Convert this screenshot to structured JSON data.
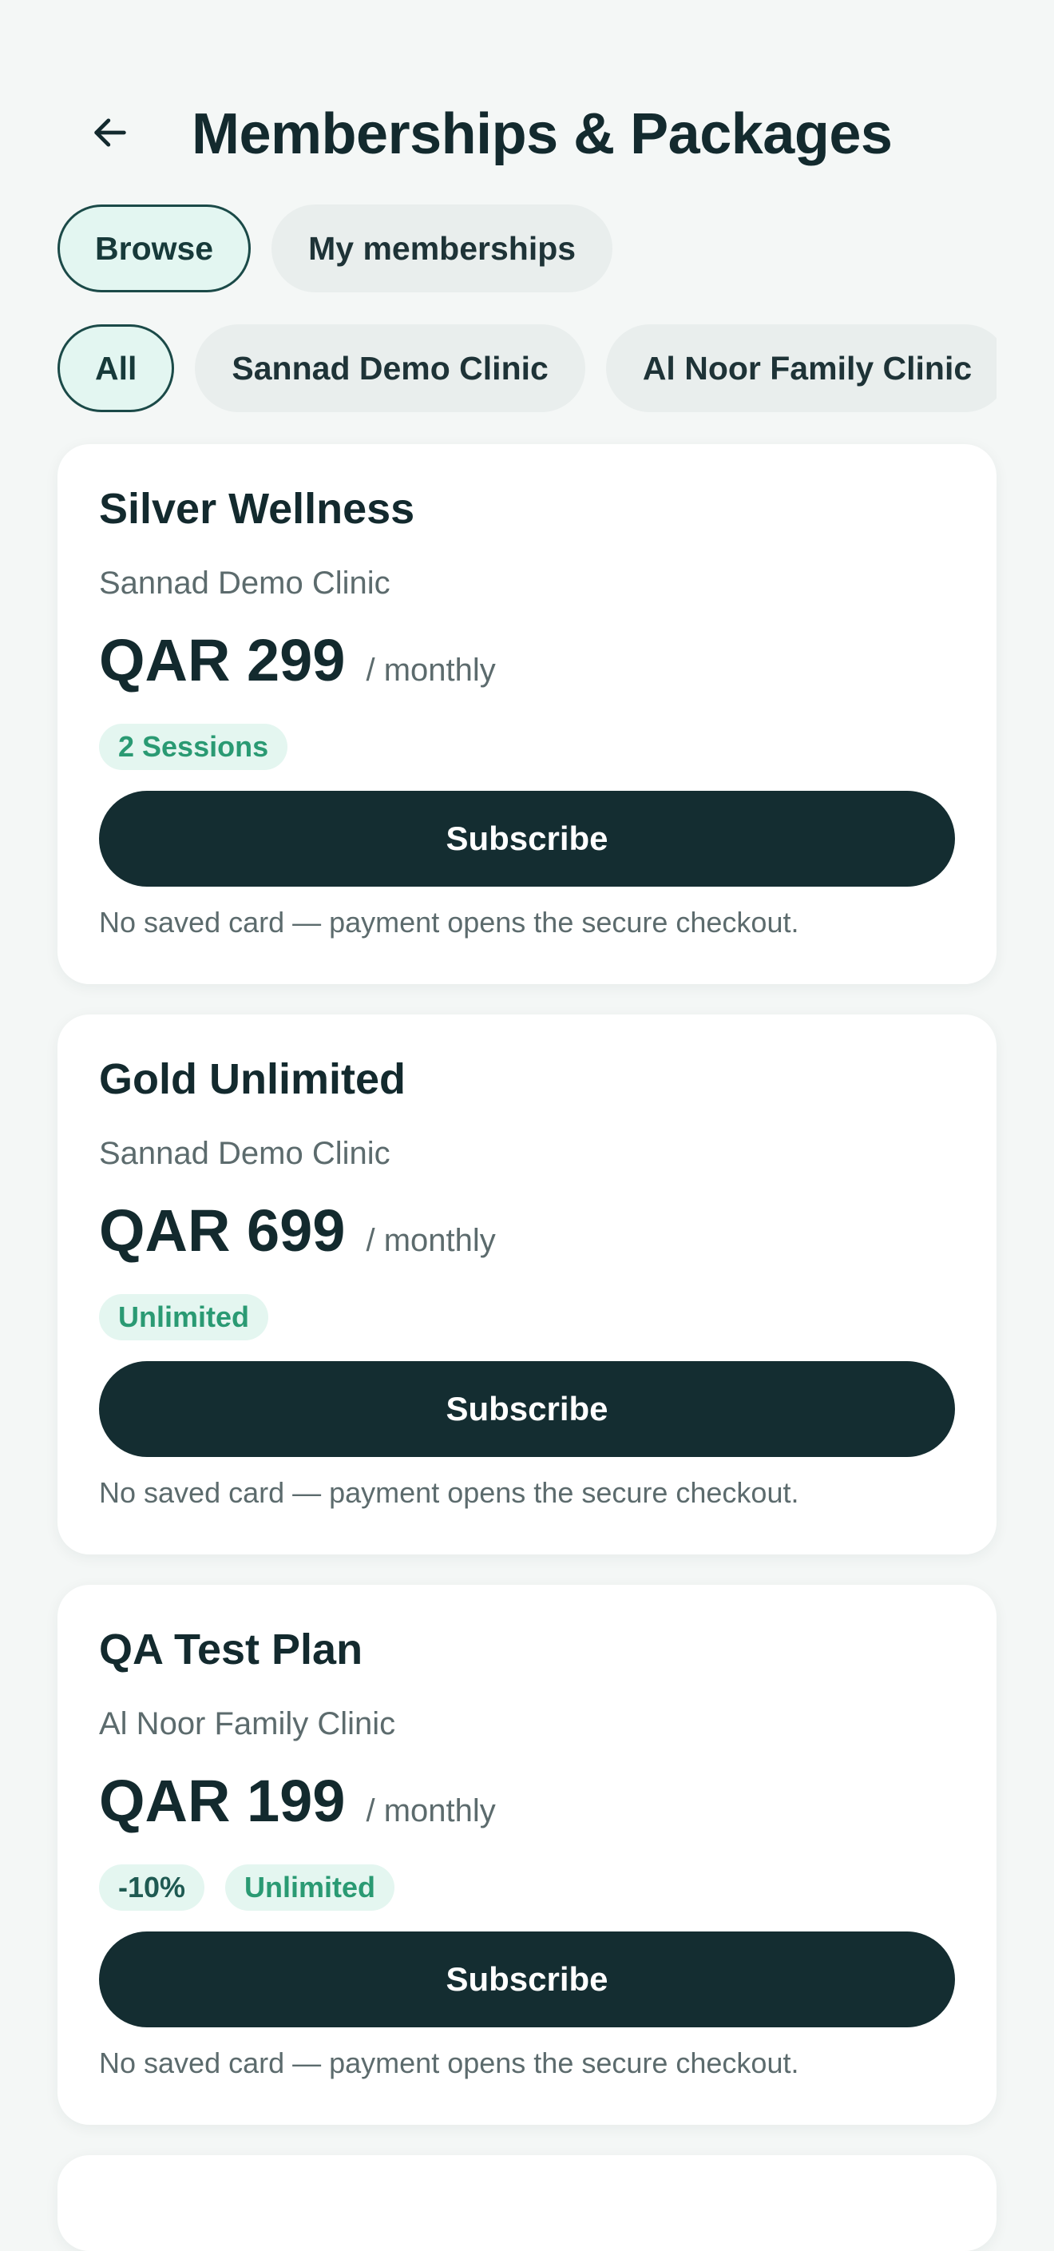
{
  "header": {
    "title": "Memberships & Packages",
    "back_icon": "arrow-left-icon"
  },
  "tabs": [
    {
      "label": "Browse",
      "active": true
    },
    {
      "label": "My memberships",
      "active": false
    }
  ],
  "clinic_filters": [
    {
      "label": "All",
      "active": true
    },
    {
      "label": "Sannad Demo Clinic",
      "active": false
    },
    {
      "label": "Al Noor Family Clinic",
      "active": false
    }
  ],
  "plans": [
    {
      "name": "Silver Wellness",
      "clinic": "Sannad Demo Clinic",
      "price": "QAR 299",
      "period": "/ monthly",
      "badges": [
        "2 Sessions"
      ],
      "button": "Subscribe",
      "note": "No saved card — payment opens the secure checkout."
    },
    {
      "name": "Gold Unlimited",
      "clinic": "Sannad Demo Clinic",
      "price": "QAR 699",
      "period": "/ monthly",
      "badges": [
        "Unlimited"
      ],
      "button": "Subscribe",
      "note": "No saved card — payment opens the secure checkout."
    },
    {
      "name": "QA Test Plan",
      "clinic": "Al Noor Family Clinic",
      "price": "QAR 199",
      "period": "/ monthly",
      "badges": [
        "-10%",
        "Unlimited"
      ],
      "button": "Subscribe",
      "note": "No saved card — payment opens the secure checkout."
    }
  ],
  "colors": {
    "background": "#f4f7f6",
    "primary_dark": "#142d31",
    "accent_green": "#2a9a73",
    "badge_bg": "#e4f6f0",
    "active_pill_bg": "#e3f6f1"
  }
}
